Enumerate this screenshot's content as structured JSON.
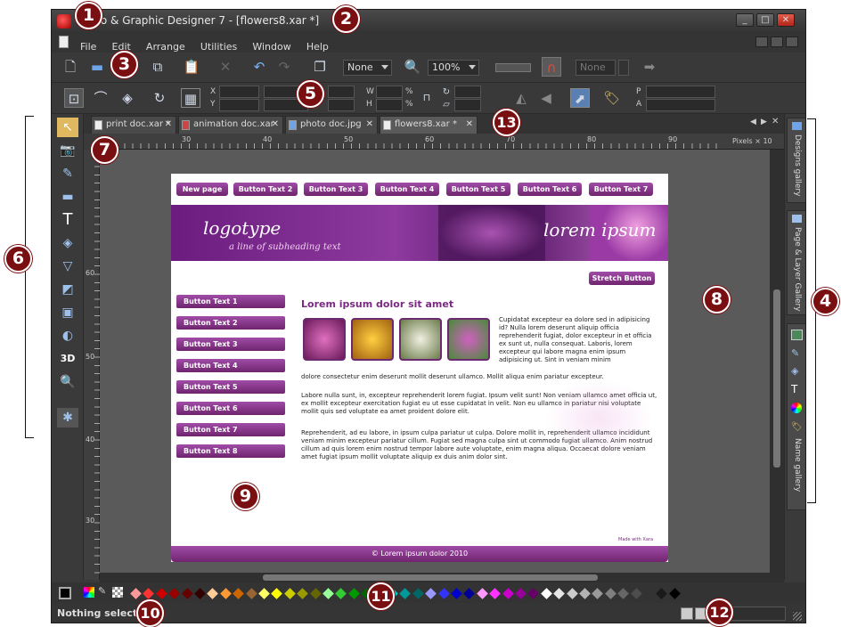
{
  "window": {
    "title": "Photo & Graphic Designer 7 - [flowers8.xar *]",
    "controls": {
      "minimize": "_",
      "maximize": "□",
      "close": "✕"
    }
  },
  "menubar": {
    "items": [
      "File",
      "Edit",
      "Arrange",
      "Utilities",
      "Window",
      "Help"
    ]
  },
  "toolbar": {
    "feather_value": "None",
    "zoom_value": "100%",
    "disabled_combo": "None"
  },
  "infobar": {
    "labels": {
      "x": "X",
      "y": "Y",
      "w": "W",
      "h": "H",
      "p": "P",
      "a": "A",
      "pct": "%"
    }
  },
  "tabs": [
    {
      "label": "print doc.xar *"
    },
    {
      "label": "animation doc.xar"
    },
    {
      "label": "photo doc.jpg"
    },
    {
      "label": "flowers8.xar *"
    }
  ],
  "ruler": {
    "h_ticks": [
      "30",
      "40",
      "50",
      "60",
      "70",
      "80",
      "90"
    ],
    "v_ticks": [
      "60",
      "50",
      "40",
      "30"
    ],
    "units": "Pixels × 10"
  },
  "webpage": {
    "nav": [
      "New page",
      "Button Text 2",
      "Button Text 3",
      "Button Text 4",
      "Button Text 5",
      "Button Text 6",
      "Button Text 7"
    ],
    "logo": "logotype",
    "tagline": "a line of subheading text",
    "banner_right": "lorem ipsum",
    "stretch_button": "Stretch Button",
    "side_buttons": [
      "Button Text 1",
      "Button Text 2",
      "Button Text 3",
      "Button Text 4",
      "Button Text 5",
      "Button Text 6",
      "Button Text 7",
      "Button Text 8"
    ],
    "heading": "Lorem ipsum dolor sit amet",
    "para1": "Cupidatat excepteur ea dolore sed in adipisicing id? Nulla lorem deserunt aliquip officia reprehenderit fugiat, dolor excepteur in et officia ex sunt ut, nulla consequat. Laboris, lorem excepteur qui labore magna enim ipsum adipisicing ut. Sint in veniam minim",
    "para1_cont": "dolore consectetur enim deserunt mollit deserunt ullamco. Mollit aliqua enim pariatur excepteur.",
    "para2": "Labore nulla sunt, in, excepteur reprehenderit lorem fugiat. Ipsum velit sunt! Non veniam ullamco amet officia ut, ex mollit excepteur exercitation fugiat eu ut esse cupidatat in velit. Non eu ullamco in pariatur nisi voluptate mollit quis sed voluptate ea amet proident dolore elit.",
    "para3": "Reprehenderit, ad eu labore, in ipsum culpa pariatur ut culpa. Dolore mollit in, reprehenderit ullamco incididunt veniam minim excepteur pariatur cillum. Fugiat sed magna culpa sint ut commodo fugiat ullamco. Anim nostrud cillum ad quis lorem enim nostrud tempor labore aute voluptate, enim magna aliqua. Occaecat dolore veniam amet fugiat ipsum mollit voluptate aliquip ex duis anim dolor sint.",
    "made_with": "Made with Xara",
    "footer": "© Lorem ipsum dolor 2010"
  },
  "gallery": {
    "tabs": [
      "Designs gallery",
      "Page & Layer Gallery",
      "Name gallery"
    ]
  },
  "status": {
    "text": "Nothing selected:"
  },
  "palette_colors": [
    "#ff9999",
    "#ff3333",
    "#cc0000",
    "#990000",
    "#660000",
    "#330000",
    "#ffcc99",
    "#ff9933",
    "#cc6600",
    "#996633",
    "#ffff66",
    "#ffff00",
    "#cccc00",
    "#999900",
    "#666600",
    "#99ff99",
    "#33cc33",
    "#009900",
    "#006600",
    "#66ffff",
    "#00cccc",
    "#009999",
    "#006666",
    "#9999ff",
    "#3333ff",
    "#0000cc",
    "#000099",
    "#ff99ff",
    "#ff33ff",
    "#cc00cc",
    "#990099",
    "#660066",
    "#ffffff",
    "#e6e6e6",
    "#cccccc",
    "#b3b3b3",
    "#999999",
    "#808080",
    "#666666",
    "#4d4d4d",
    "#333333",
    "#1a1a1a",
    "#000000"
  ],
  "callouts": [
    "1",
    "2",
    "3",
    "4",
    "5",
    "6",
    "7",
    "8",
    "9",
    "10",
    "11",
    "12",
    "13"
  ]
}
